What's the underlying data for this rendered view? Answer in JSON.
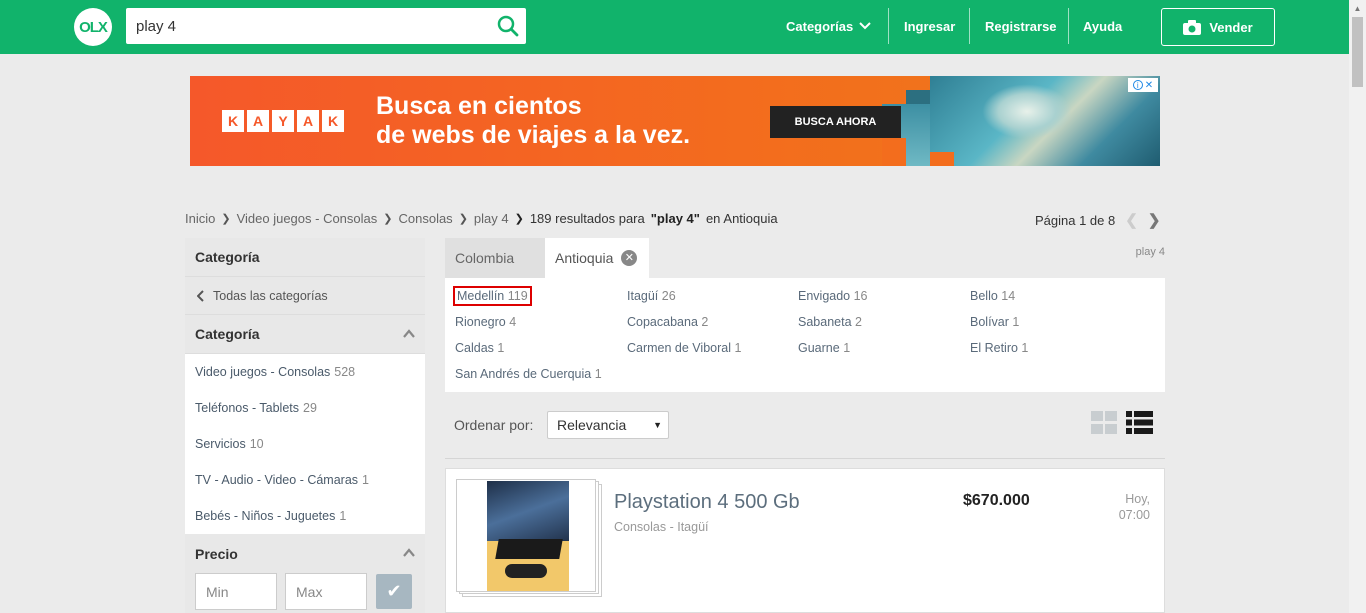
{
  "header": {
    "logo": "OLX",
    "search_value": "play 4",
    "search_icon": "magnifier",
    "nav": {
      "categorias": "Categorías",
      "ingresar": "Ingresar",
      "registrarse": "Registrarse",
      "ayuda": "Ayuda",
      "vender": "Vender"
    },
    "brand_color": "#11b36b"
  },
  "ad": {
    "brand": [
      "K",
      "A",
      "Y",
      "A",
      "K"
    ],
    "line1": "Busca en cientos",
    "line2": "de webs de viajes a la vez.",
    "button": "BUSCA AHORA"
  },
  "breadcrumb": {
    "items": [
      "Inicio",
      "Video juegos - Consolas",
      "Consolas",
      "play 4"
    ],
    "results_count": "189 resultados para",
    "query": "\"play 4\"",
    "location_prefix": "en",
    "location": "Antioquia"
  },
  "pager": {
    "text": "Página 1 de 8"
  },
  "sidebar": {
    "category_title": "Categoría",
    "back_label": "Todas las categorías",
    "category_title_2": "Categoría",
    "categories": [
      {
        "label": "Video juegos - Consolas",
        "count": "528"
      },
      {
        "label": "Teléfonos - Tablets",
        "count": "29"
      },
      {
        "label": "Servicios",
        "count": "10"
      },
      {
        "label": "TV - Audio - Video - Cámaras",
        "count": "1"
      },
      {
        "label": "Bebés - Niños - Juguetes",
        "count": "1"
      }
    ],
    "price_title": "Precio",
    "min_placeholder": "Min",
    "max_placeholder": "Max"
  },
  "location_tabs": {
    "country": "Colombia",
    "region": "Antioquia",
    "query_tag": "play 4"
  },
  "cities": [
    {
      "name": "Medellín",
      "count": "119"
    },
    {
      "name": "Itagüí",
      "count": "26"
    },
    {
      "name": "Envigado",
      "count": "16"
    },
    {
      "name": "Bello",
      "count": "14"
    },
    {
      "name": "Rionegro",
      "count": "4"
    },
    {
      "name": "Copacabana",
      "count": "2"
    },
    {
      "name": "Sabaneta",
      "count": "2"
    },
    {
      "name": "Bolívar",
      "count": "1"
    },
    {
      "name": "Caldas",
      "count": "1"
    },
    {
      "name": "Carmen de Viboral",
      "count": "1"
    },
    {
      "name": "Guarne",
      "count": "1"
    },
    {
      "name": "El Retiro",
      "count": "1"
    },
    {
      "name": "San Andrés de Cuerquia",
      "count": "1"
    }
  ],
  "sort": {
    "label": "Ordenar por:",
    "selected": "Relevancia"
  },
  "listing": {
    "title": "Playstation 4 500 Gb",
    "subtitle": "Consolas - Itagüí",
    "price": "$670.000",
    "date_line1": "Hoy,",
    "date_line2": "07:00"
  }
}
